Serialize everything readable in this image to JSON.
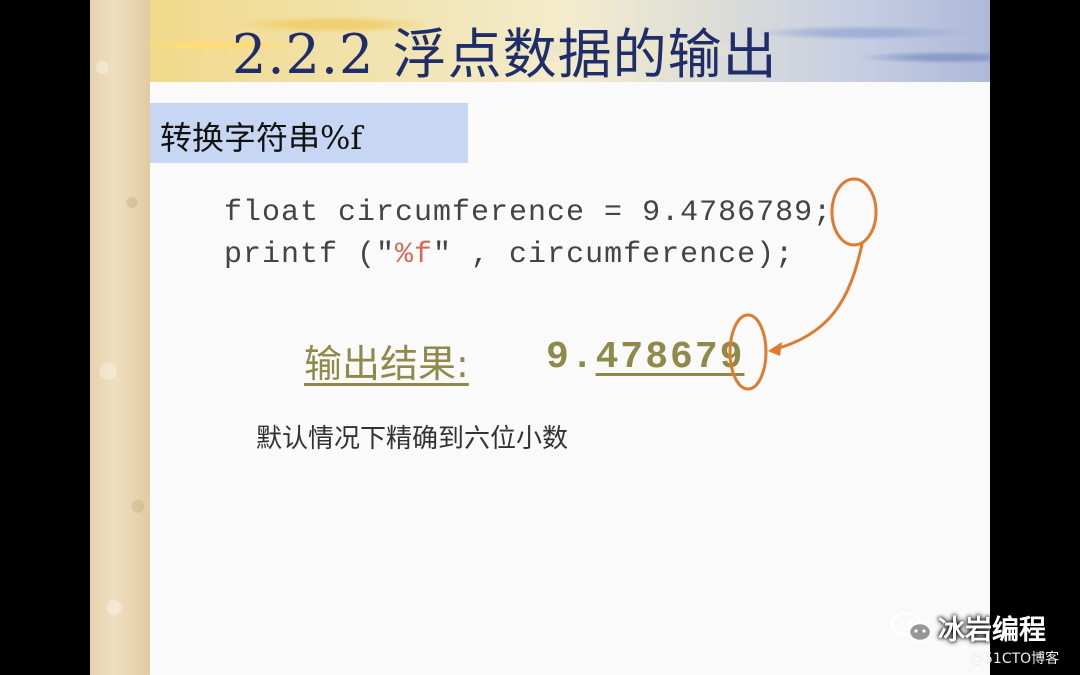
{
  "slide": {
    "title": "2.2.2 浮点数据的输出",
    "subtitle": "转换字符串%f",
    "code": {
      "line1": "float circumference = 9.4786789;",
      "line2_prefix": "printf (\"",
      "line2_format": "%f",
      "line2_suffix": "\" , circumference);"
    },
    "result": {
      "label": "输出结果:",
      "value_head": "9.",
      "value_underlined": "478679"
    },
    "note": "默认情况下精确到六位小数"
  },
  "watermark": {
    "brand": "冰岩编程",
    "blog": "@51CTO博客",
    "icon": "wechat-icon"
  },
  "colors": {
    "title": "#1f2d6b",
    "subtitle_bg": "#c7d6f2",
    "result": "#8f8a4a",
    "format_spec": "#d86b56",
    "annotation": "#e07b2e"
  }
}
